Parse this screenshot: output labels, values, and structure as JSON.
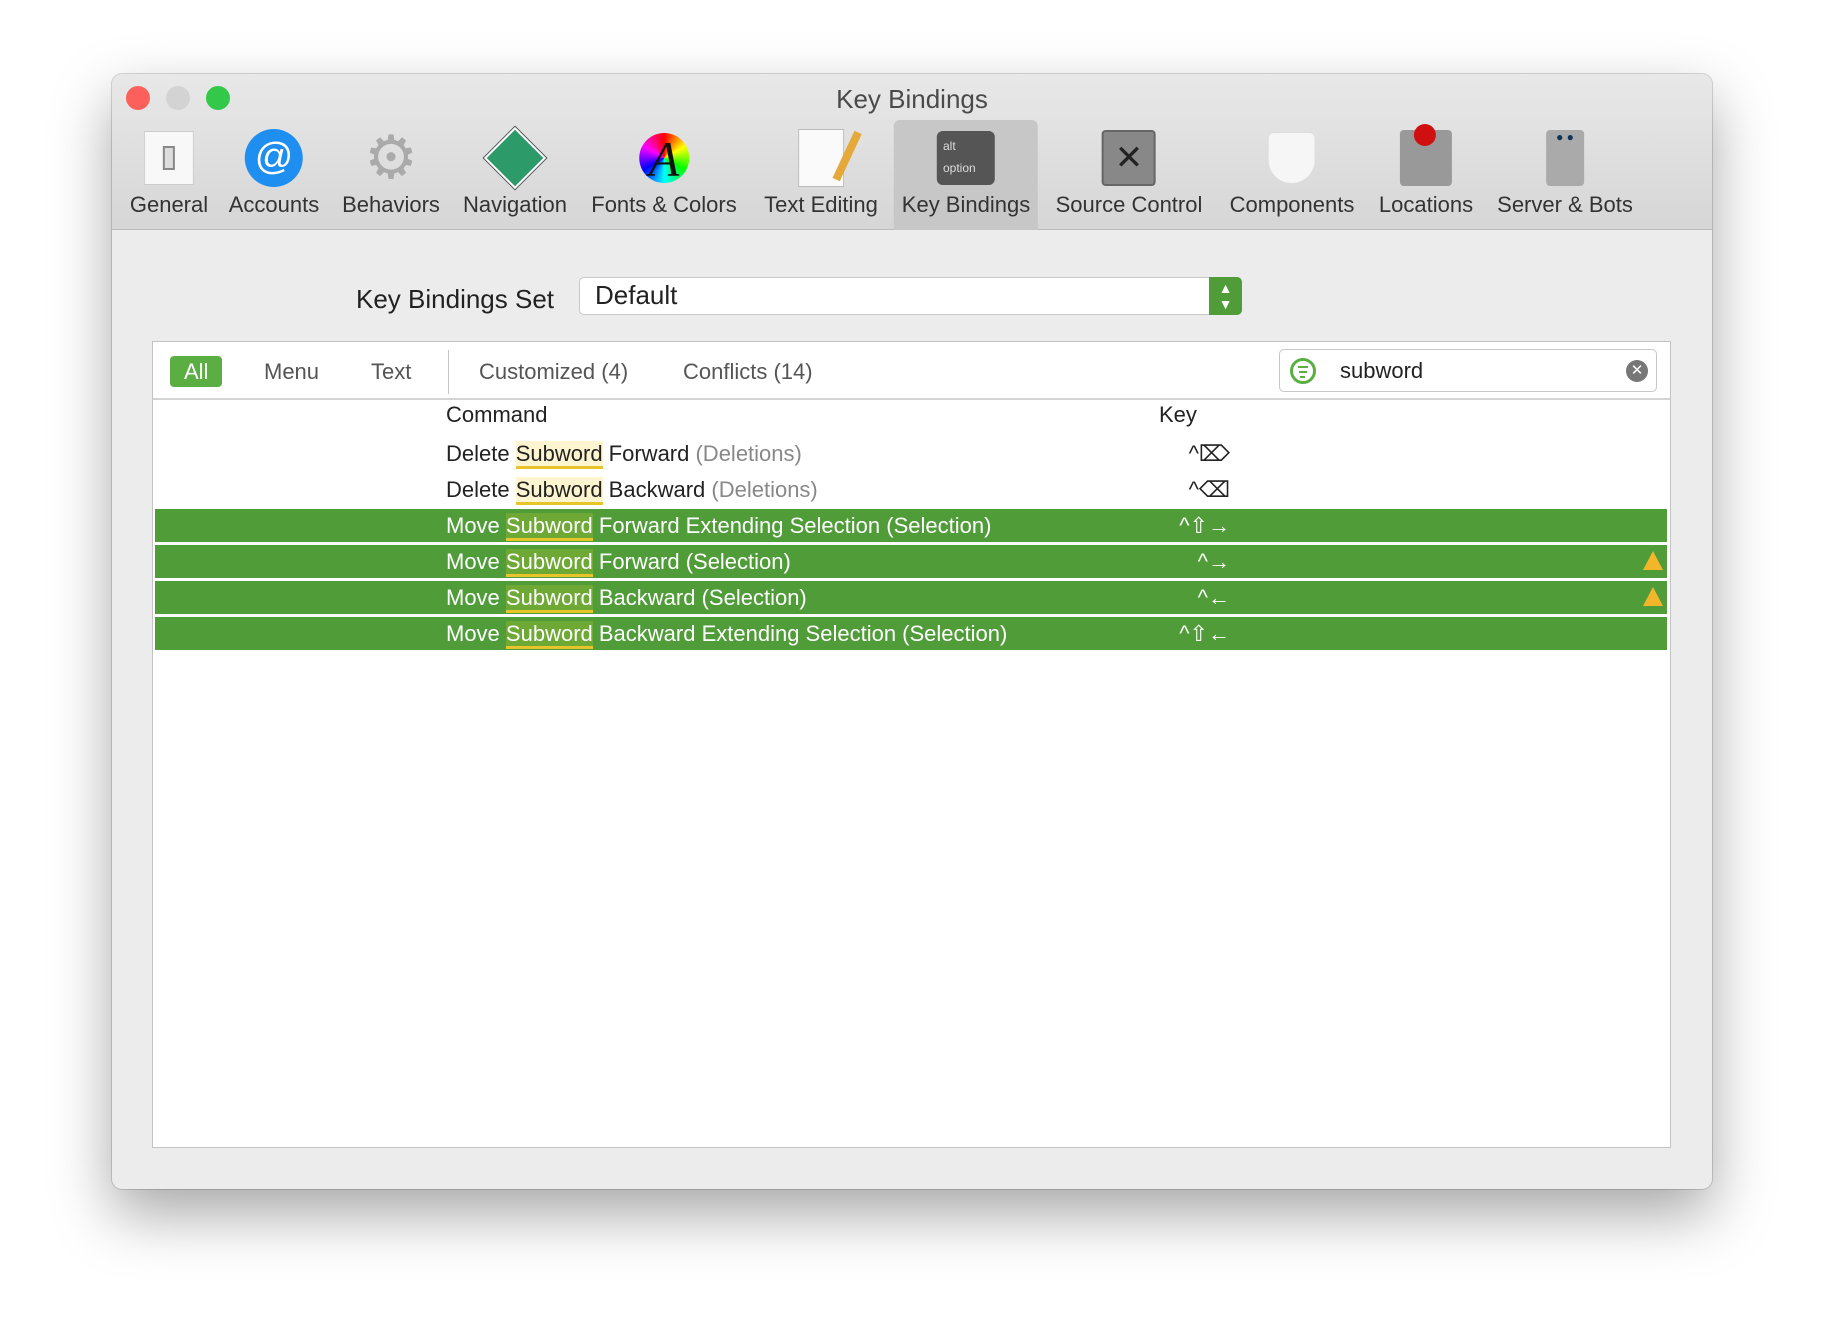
{
  "window": {
    "title": "Key Bindings"
  },
  "toolbar": [
    {
      "label": "General",
      "icon": "switch-icon"
    },
    {
      "label": "Accounts",
      "icon": "at-icon"
    },
    {
      "label": "Behaviors",
      "icon": "gear-icon"
    },
    {
      "label": "Navigation",
      "icon": "move-arrows-icon"
    },
    {
      "label": "Fonts & Colors",
      "icon": "font-color-icon"
    },
    {
      "label": "Text Editing",
      "icon": "document-pencil-icon"
    },
    {
      "label": "Key Bindings",
      "icon": "option-key-icon",
      "selected": true,
      "key_top": "alt",
      "key_bottom": "option"
    },
    {
      "label": "Source Control",
      "icon": "safe-icon"
    },
    {
      "label": "Components",
      "icon": "lego-brick-icon"
    },
    {
      "label": "Locations",
      "icon": "joystick-drive-icon"
    },
    {
      "label": "Server & Bots",
      "icon": "robot-icon"
    }
  ],
  "keyset": {
    "label": "Key Bindings Set",
    "value": "Default"
  },
  "filters": {
    "all": "All",
    "menu": "Menu",
    "text": "Text",
    "customized": "Customized (4)",
    "conflicts": "Conflicts (14)"
  },
  "search": {
    "value": "subword"
  },
  "columns": {
    "command": "Command",
    "key": "Key"
  },
  "rows": [
    {
      "pre": "Delete ",
      "match": "Subword",
      "post": " Forward ",
      "cat": "(Deletions)",
      "key": "^⌦",
      "selected": false,
      "conflict": false
    },
    {
      "pre": "Delete ",
      "match": "Subword",
      "post": " Backward ",
      "cat": "(Deletions)",
      "key": "^⌫",
      "selected": false,
      "conflict": false
    },
    {
      "pre": "Move ",
      "match": "Subword",
      "post": " Forward Extending Selection ",
      "cat": "(Selection)",
      "key": "^⇧→",
      "selected": true,
      "conflict": false
    },
    {
      "pre": "Move ",
      "match": "Subword",
      "post": " Forward ",
      "cat": "(Selection)",
      "key": "^→",
      "selected": true,
      "conflict": true
    },
    {
      "pre": "Move ",
      "match": "Subword",
      "post": " Backward ",
      "cat": "(Selection)",
      "key": "^←",
      "selected": true,
      "conflict": true
    },
    {
      "pre": "Move ",
      "match": "Subword",
      "post": " Backward Extending Selection ",
      "cat": "(Selection)",
      "key": "^⇧←",
      "selected": true,
      "conflict": false
    }
  ],
  "colors": {
    "accent": "#4f9c38",
    "highlight": "#fcf5cf",
    "warning": "#f3b62b"
  }
}
